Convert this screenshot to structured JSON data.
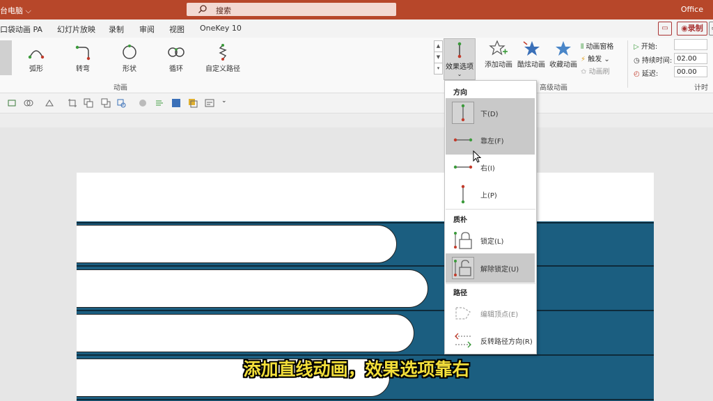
{
  "titlebar": {
    "left_text": "台电脑",
    "search_placeholder": "搜索",
    "brand": "Office"
  },
  "tabs": [
    "口袋动画 PA",
    "幻灯片放映",
    "录制",
    "审阅",
    "视图",
    "OneKey 10"
  ],
  "record_label": "录制",
  "ribbon": {
    "animations": [
      {
        "label": "弧形",
        "icon": "arc-path-icon"
      },
      {
        "label": "转弯",
        "icon": "turn-path-icon"
      },
      {
        "label": "形状",
        "icon": "shape-path-icon"
      },
      {
        "label": "循环",
        "icon": "loop-path-icon"
      },
      {
        "label": "自定义路径",
        "icon": "custom-path-icon"
      }
    ],
    "effect_options_label": "效果选项",
    "group_animation": "动画",
    "advanced": {
      "add_animation": "添加动画",
      "hover_animation": "酷炫动画",
      "collect_animation": "收藏动画",
      "animation_pane": "动画窗格",
      "trigger": "触发",
      "animation_painter": "动画刷",
      "group_label": "高级动画"
    },
    "timing": {
      "start_label": "开始:",
      "duration_label": "持续时间:",
      "duration_value": "02.00",
      "delay_label": "延迟:",
      "delay_value": "00.00",
      "group_label": "计时"
    }
  },
  "dropdown": {
    "section_direction": "方向",
    "items_direction": [
      {
        "label": "下(D)",
        "icon": "direction-down-icon",
        "state": "selected"
      },
      {
        "label": "靠左(F)",
        "icon": "direction-left-icon",
        "state": "hover"
      },
      {
        "label": "右(I)",
        "icon": "direction-right-icon",
        "state": "normal"
      },
      {
        "label": "上(P)",
        "icon": "direction-up-icon",
        "state": "normal"
      }
    ],
    "section_origin": "质朴",
    "items_origin": [
      {
        "label": "锁定(L)",
        "icon": "lock-icon",
        "state": "normal"
      },
      {
        "label": "解除锁定(U)",
        "icon": "unlock-icon",
        "state": "selected"
      }
    ],
    "section_path": "路径",
    "items_path": [
      {
        "label": "编辑顶点(E)",
        "icon": "edit-points-icon",
        "state": "disabled"
      },
      {
        "label": "反转路径方向(R)",
        "icon": "reverse-path-icon",
        "state": "normal"
      }
    ]
  },
  "subtitle": "添加直线动画，效果选项靠右",
  "colors": {
    "titlebar": "#b7472a",
    "slide_band": "#1b5e80",
    "subtitle": "#f3df3a"
  }
}
